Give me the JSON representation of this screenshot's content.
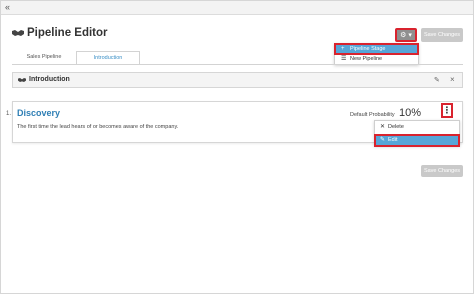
{
  "topbar": {
    "collapse_icon": "double-chevron-left"
  },
  "page": {
    "title": "Pipeline Editor",
    "title_icon": "handshake-icon"
  },
  "toolbar": {
    "settings_icon": "gear-icon",
    "caret_icon": "caret-down-icon",
    "save_label": "Save Changes"
  },
  "settings_menu": {
    "items": [
      {
        "icon": "+",
        "label": "Pipeline Stage",
        "active": true
      },
      {
        "icon": "☰",
        "label": "New Pipeline",
        "active": false
      }
    ]
  },
  "tabs": [
    {
      "label": "Sales Pipeline",
      "active": false
    },
    {
      "label": "Introduction",
      "active": true
    }
  ],
  "pipeline_panel": {
    "title": "Introduction"
  },
  "stage": {
    "number": "1.",
    "name": "Discovery",
    "description": "The first time the lead hears of or becomes aware of the company.",
    "probability_label": "Default Probability",
    "probability_value": "10%"
  },
  "stage_menu": {
    "items": [
      {
        "icon": "✕",
        "label": "Delete",
        "active": false
      },
      {
        "icon": "✎",
        "label": "Edit",
        "active": true
      }
    ]
  },
  "footer": {
    "save_label": "Save Changes"
  },
  "colors": {
    "accent": "#56a6d8",
    "link": "#2f7fb5",
    "highlight": "#d9232e",
    "disabled_button": "#c9c9c9"
  }
}
